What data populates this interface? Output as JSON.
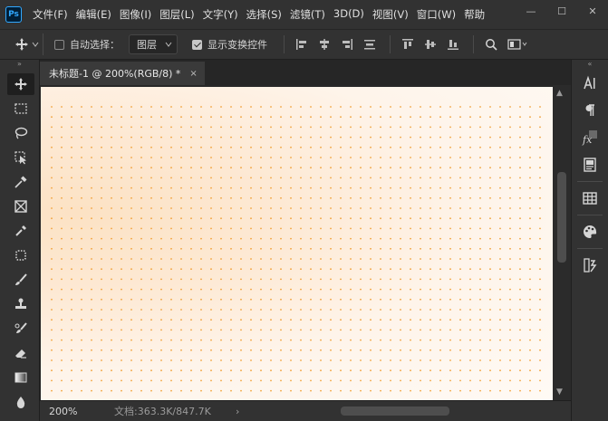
{
  "app": {
    "logo": "Ps",
    "accent": "#31a8ff"
  },
  "menu": {
    "items": [
      "文件(F)",
      "编辑(E)",
      "图像(I)",
      "图层(L)",
      "文字(Y)",
      "选择(S)",
      "滤镜(T)",
      "3D(D)",
      "视图(V)",
      "窗口(W)",
      "帮助"
    ]
  },
  "window_controls": {
    "minimize": "—",
    "maximize": "☐",
    "close": "✕"
  },
  "options": {
    "auto_select_label": "自动选择：",
    "auto_select_checked": false,
    "target_value": "图层",
    "show_transform_label": "显示变换控件",
    "show_transform_checked": true
  },
  "document": {
    "tab_title": "未标题-1 @ 200%(RGB/8) *",
    "tab_close": "×",
    "canvas_background": "#fef4ea",
    "dot_color": "#f2a33a"
  },
  "status": {
    "zoom": "200%",
    "doc_info": "文档:363.3K/847.7K",
    "arrow": "›"
  },
  "toolbar": {
    "collapse": "»",
    "tools": [
      "move-tool-icon",
      "marquee-tool-icon",
      "lasso-tool-icon",
      "object-selection-tool-icon",
      "eyedropper-tool-icon",
      "frame-tool-icon",
      "color-sampler-icon",
      "patch-tool-icon",
      "brush-tool-icon",
      "stamp-tool-icon",
      "history-brush-icon",
      "eraser-tool-icon",
      "gradient-tool-icon",
      "blur-tool-icon"
    ]
  },
  "right_panel": {
    "collapse": "«",
    "icons": [
      "character-panel-icon",
      "paragraph-panel-icon",
      "styles-panel-icon",
      "libraries-panel-icon",
      "swatches-panel-icon",
      "color-panel-icon",
      "adjustments-panel-icon"
    ]
  }
}
